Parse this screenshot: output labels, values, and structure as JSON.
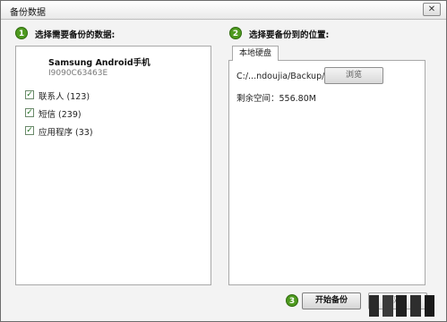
{
  "window": {
    "title": "备份数据",
    "close_glyph": "✕"
  },
  "step1": {
    "number": "1",
    "label": "选择需要备份的数据:",
    "device_name": "Samsung Android手机",
    "device_id": "I9090C63463E",
    "items": [
      {
        "label": "联系人 (123)",
        "checked": true
      },
      {
        "label": "短信 (239)",
        "checked": true
      },
      {
        "label": "应用程序 (33)",
        "checked": true
      }
    ]
  },
  "step2": {
    "number": "2",
    "label": "选择要备份到的位置:",
    "tab_label": "本地硬盘",
    "path": "C:/...ndoujia/Backup/",
    "browse_label": "浏览",
    "free_space": "剩余空间：556.80M"
  },
  "step3": {
    "number": "3",
    "start_label": "开始备份",
    "cancel_label": "取消"
  },
  "colors": {
    "step_badge": "#4e9a1f",
    "panel_border": "#a9a9a9",
    "window_bg": "#f3f3f3"
  },
  "icons": {
    "checkbox": "check-mark",
    "close": "close-icon"
  }
}
